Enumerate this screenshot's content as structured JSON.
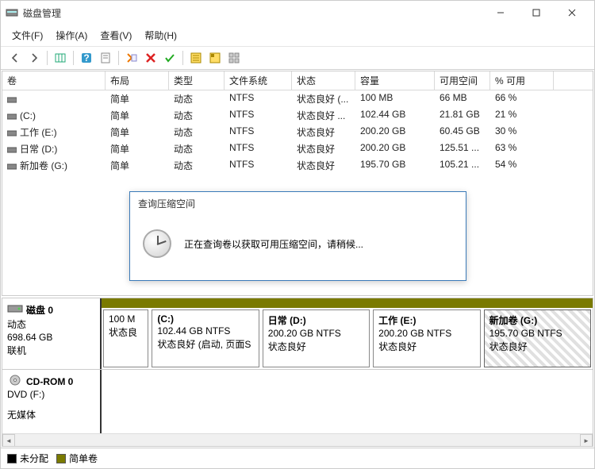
{
  "window": {
    "title": "磁盘管理"
  },
  "menu": {
    "file": "文件(F)",
    "action": "操作(A)",
    "view": "查看(V)",
    "help": "帮助(H)"
  },
  "table": {
    "headers": {
      "volume": "卷",
      "layout": "布局",
      "type": "类型",
      "fs": "文件系统",
      "status": "状态",
      "capacity": "容量",
      "free": "可用空间",
      "pct": "% 可用"
    },
    "rows": [
      {
        "volume": "",
        "layout": "简单",
        "type": "动态",
        "fs": "NTFS",
        "status": "状态良好 (...",
        "capacity": "100 MB",
        "free": "66 MB",
        "pct": "66 %"
      },
      {
        "volume": "(C:)",
        "layout": "简单",
        "type": "动态",
        "fs": "NTFS",
        "status": "状态良好 ...",
        "capacity": "102.44 GB",
        "free": "21.81 GB",
        "pct": "21 %"
      },
      {
        "volume": "工作 (E:)",
        "layout": "简单",
        "type": "动态",
        "fs": "NTFS",
        "status": "状态良好",
        "capacity": "200.20 GB",
        "free": "60.45 GB",
        "pct": "30 %"
      },
      {
        "volume": "日常 (D:)",
        "layout": "简单",
        "type": "动态",
        "fs": "NTFS",
        "status": "状态良好",
        "capacity": "200.20 GB",
        "free": "125.51 ...",
        "pct": "63 %"
      },
      {
        "volume": "新加卷 (G:)",
        "layout": "简单",
        "type": "动态",
        "fs": "NTFS",
        "status": "状态良好",
        "capacity": "195.70 GB",
        "free": "105.21 ...",
        "pct": "54 %"
      }
    ]
  },
  "disks": {
    "disk0": {
      "name": "磁盘 0",
      "type": "动态",
      "capacity": "698.64 GB",
      "status": "联机",
      "partitions": [
        {
          "name": "",
          "line1": "100 M",
          "line2": "状态良",
          "flex": 0.5
        },
        {
          "name": "(C:)",
          "line1": "102.44 GB NTFS",
          "line2": "状态良好 (启动, 页面S",
          "flex": 1.4
        },
        {
          "name": "日常  (D:)",
          "line1": "200.20 GB NTFS",
          "line2": "状态良好",
          "flex": 1.4
        },
        {
          "name": "工作  (E:)",
          "line1": "200.20 GB NTFS",
          "line2": "状态良好",
          "flex": 1.4
        },
        {
          "name": "新加卷  (G:)",
          "line1": "195.70 GB NTFS",
          "line2": "状态良好",
          "flex": 1.4,
          "selected": true
        }
      ]
    },
    "cdrom": {
      "name": "CD-ROM 0",
      "type": "DVD (F:)",
      "status": "无媒体"
    }
  },
  "legend": {
    "unallocated": "未分配",
    "simple": "简单卷"
  },
  "dialog": {
    "title": "查询压缩空间",
    "message": "正在查询卷以获取可用压缩空间，请稍候..."
  }
}
